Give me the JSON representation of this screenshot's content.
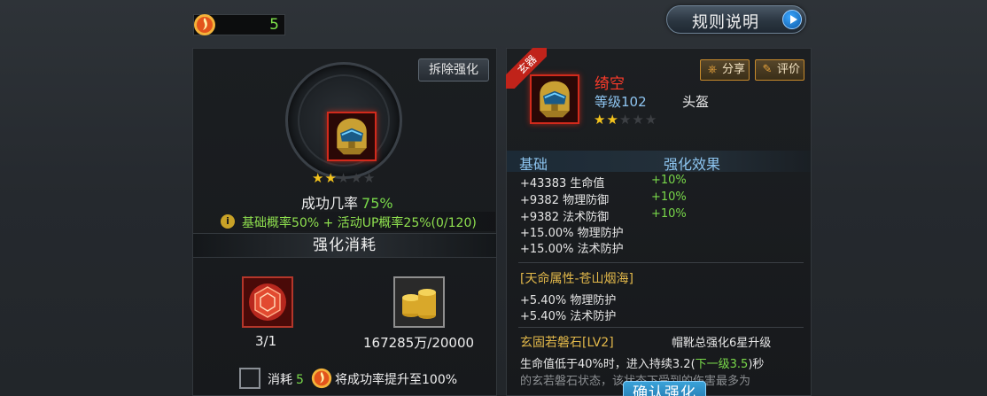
{
  "currency": {
    "count": "5",
    "icon": "flame-token-icon"
  },
  "header": {
    "rules_label": "规则说明"
  },
  "forge": {
    "remove_label": "拆除强化",
    "stars_total": 5,
    "stars_filled": 2,
    "success_label": "成功几率",
    "success_rate": "75%",
    "probability_text": "基础概率50% + 活动UP概率25%(0/120)",
    "cost_title": "强化消耗",
    "materials": [
      {
        "name": "refine-stone",
        "count": "3/1"
      },
      {
        "name": "gold-coins",
        "count": "167285万/20000"
      }
    ],
    "consume_label": "消耗",
    "consume_count": "5",
    "consume_text": "将成功率提升至100%"
  },
  "item": {
    "rarity_tag": "玄器",
    "name": "绮空",
    "level": "等级102",
    "type": "头盔",
    "stars_total": 5,
    "stars_filled": 2,
    "share_label": "分享",
    "rate_label": "评价",
    "stats_header_base": "基础",
    "stats_header_effect": "强化效果",
    "base_stats": [
      {
        "text": "+43383 生命值",
        "bonus": "+10%"
      },
      {
        "text": "+9382 物理防御",
        "bonus": "+10%"
      },
      {
        "text": "+9382 法术防御",
        "bonus": "+10%"
      },
      {
        "text": "+15.00% 物理防护",
        "bonus": ""
      },
      {
        "text": "+15.00% 法术防护",
        "bonus": ""
      }
    ],
    "fate_title": "[天命属性-苍山烟海]",
    "fate_stats": [
      "+5.40% 物理防护",
      "+5.40% 法术防护"
    ],
    "gem_title": "玄固若磐石[LV2]",
    "gem_note": "帽靴总强化6星升级",
    "effect_prefix": "生命值低于40%时，进入持续3.2(",
    "effect_highlight": "下一级3.5",
    "effect_suffix": ")秒",
    "effect_line2": "的玄若磐石状态，该状态下受到的伤害最多为"
  },
  "confirm_label": "确认强化",
  "colors": {
    "accent_green": "#79d94a",
    "item_red": "#ff3b2a",
    "level_blue": "#8fc6f2",
    "gold": "#e2b84a",
    "confirm_blue": "#1e6fa6"
  }
}
